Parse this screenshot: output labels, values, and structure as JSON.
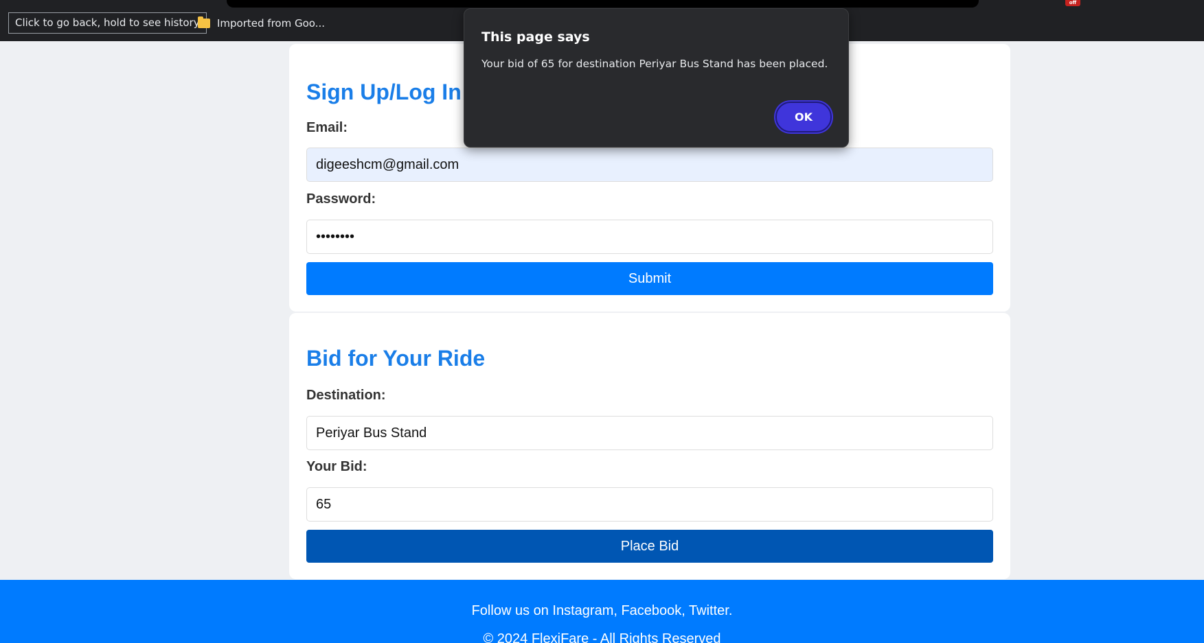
{
  "browser": {
    "back_tooltip": "Click to go back, hold to see history",
    "bookmark_folder": "Imported from Goo...",
    "extension_badge": "off"
  },
  "signup": {
    "heading": "Sign Up/Log In",
    "email_label": "Email:",
    "email_value": "digeeshcm@gmail.com",
    "password_label": "Password:",
    "password_masked": "••••••••",
    "submit_label": "Submit"
  },
  "bid": {
    "heading": "Bid for Your Ride",
    "destination_label": "Destination:",
    "destination_value": "Periyar Bus Stand",
    "bid_label": "Your Bid:",
    "bid_value": "65",
    "place_bid_label": "Place Bid"
  },
  "footer": {
    "social": "Follow us on Instagram, Facebook, Twitter.",
    "copyright": "© 2024 FlexiFare - All Rights Reserved"
  },
  "dialog": {
    "title": "This page says",
    "message": "Your bid of 65 for destination Periyar Bus Stand has been placed.",
    "ok_label": "OK"
  }
}
